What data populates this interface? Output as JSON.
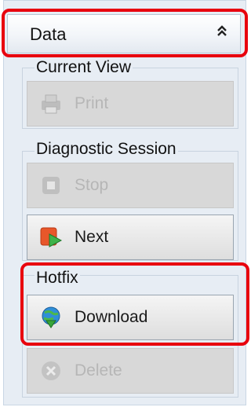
{
  "panel": {
    "header_label": "Data",
    "groups": {
      "current_view": {
        "title": "Current View",
        "print_label": "Print"
      },
      "diagnostic_session": {
        "title": "Diagnostic Session",
        "stop_label": "Stop",
        "next_label": "Next"
      },
      "hotfix": {
        "title": "Hotfix",
        "download_label": "Download",
        "delete_label": "Delete"
      }
    },
    "icons": {
      "collapse": "double-chevron-up-icon",
      "print": "printer-icon",
      "stop": "stop-icon",
      "next": "next-arrow-icon",
      "download": "globe-download-icon",
      "delete": "delete-x-icon"
    }
  },
  "colors": {
    "highlight": "#e8000e",
    "panel_bg": "#e7edf4",
    "disabled_button": "#d8d8d8"
  }
}
